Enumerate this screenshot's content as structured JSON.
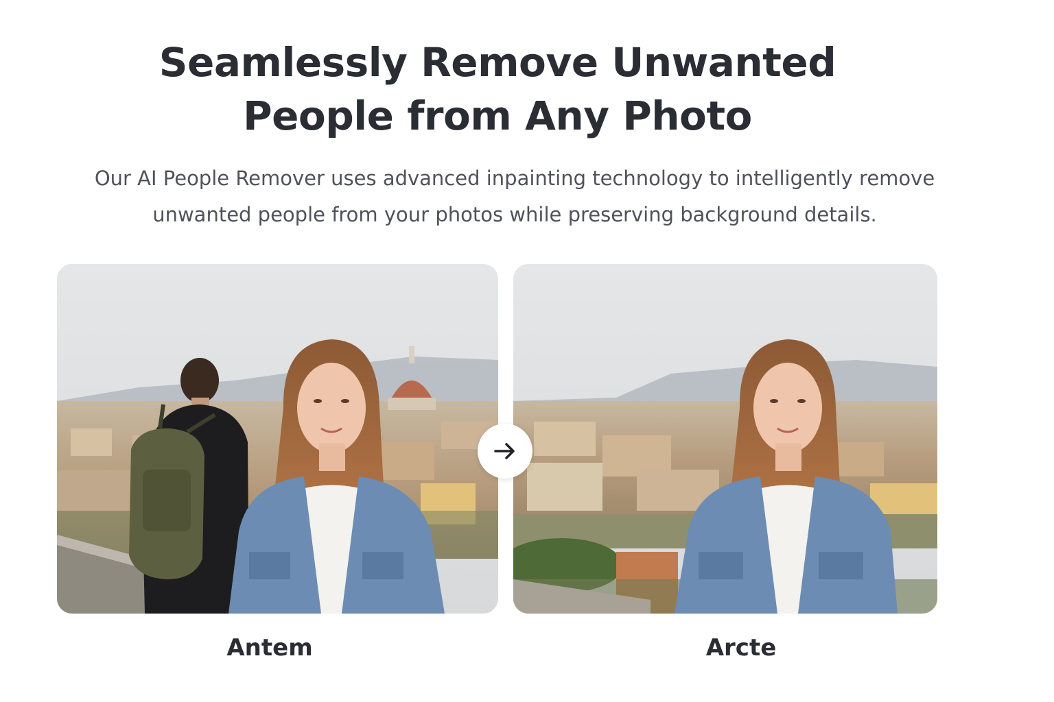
{
  "header": {
    "title": "Seamlessly Remove Unwanted People from Any Photo",
    "subtitle": "Our AI People Remover uses advanced inpainting technology to intelligently remove unwanted people from your photos while preserving background details."
  },
  "comparison": {
    "before_label": "Antem",
    "after_label": "Arcte",
    "arrow_icon": "arrow-right-icon"
  },
  "colors": {
    "heading": "#2b2d35",
    "body_text": "#4f525a",
    "background": "#ffffff"
  }
}
